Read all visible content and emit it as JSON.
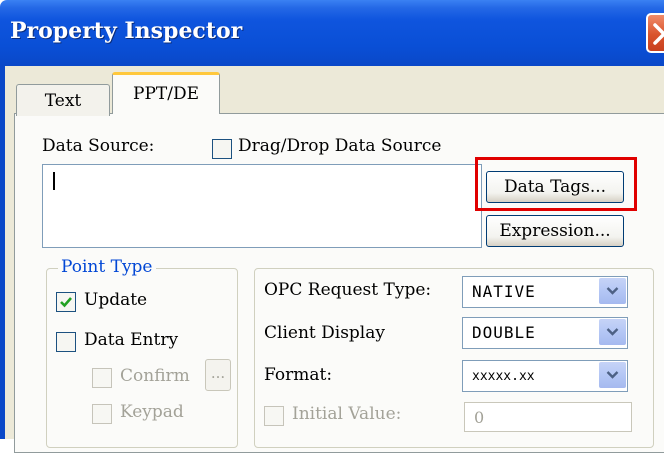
{
  "window": {
    "title": "Property Inspector"
  },
  "tabs": [
    {
      "label": "Text",
      "selected": false
    },
    {
      "label": "PPT/DE",
      "selected": true
    }
  ],
  "data_source": {
    "label": "Data Source:",
    "value": "",
    "drag_drop_label": "Drag/Drop Data Source",
    "drag_drop_checked": false,
    "data_tags_button": "Data Tags...",
    "expression_button": "Expression..."
  },
  "point_type": {
    "title": "Point Type",
    "update": {
      "label": "Update",
      "checked": true
    },
    "data_entry": {
      "label": "Data Entry",
      "checked": false
    },
    "confirm": {
      "label": "Confirm",
      "checked": false,
      "enabled": false
    },
    "confirm_button": "...",
    "keypad": {
      "label": "Keypad",
      "checked": false,
      "enabled": false
    }
  },
  "opc": {
    "request_type_label": "OPC Request Type:",
    "request_type_value": "NATIVE",
    "client_display_label": "Client Display",
    "client_display_value": "DOUBLE",
    "format_label": "Format:",
    "format_value": "xxxxx.xx",
    "initial_value_label": "Initial Value:",
    "initial_value": "0",
    "initial_value_enabled": false
  },
  "colors": {
    "title_bar": "#0a4fd6",
    "highlight_box": "#e00000",
    "group_title": "#0046d5",
    "dialog_background": "#ece9d8"
  },
  "icons": [
    "close-icon",
    "check-icon",
    "chevron-down-icon"
  ]
}
